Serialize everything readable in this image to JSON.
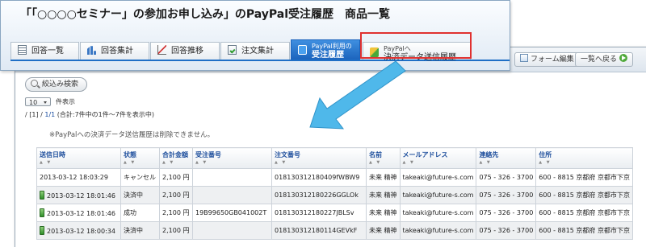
{
  "front": {
    "title": "「「○○○○セミナー」の参加お申し込み」のPayPal受注履歴　商品一覧",
    "tabs": [
      {
        "label": "回答一覧",
        "icon": "list-icon"
      },
      {
        "label": "回答集計",
        "icon": "bar-chart-icon"
      },
      {
        "label": "回答推移",
        "icon": "line-chart-icon"
      },
      {
        "label": "注文集計",
        "icon": "order-check-icon"
      },
      {
        "small": "PayPal利用の",
        "big": "受注履歴",
        "icon": "paypal-icon",
        "active": true
      },
      {
        "small": "PayPalへ",
        "big": "決済データ送信履歴",
        "icon": "send-icon"
      }
    ]
  },
  "back": {
    "toolbar": {
      "form_edit": "フォーム編集",
      "back_to_list": "一覧へ戻る"
    },
    "search_button": "絞込み検索",
    "per_page_value": "10",
    "per_page_label": "件表示",
    "pager_prefix": "/ [1] /",
    "pager_link": "1/1",
    "pager_info": "(合計:7件中の1件〜7件を表示中)",
    "notice": "※PayPalへの決済データ送信履歴は削除できません。",
    "table": {
      "sort_arrows": "▲ ▼",
      "headers": [
        "送信日時",
        "状態",
        "合計金額",
        "受注番号",
        "注文番号",
        "名前",
        "メールアドレス",
        "連絡先",
        "住所"
      ],
      "rows": [
        {
          "phone": false,
          "cells": [
            "2013-03-12 18:03:29",
            "キャンセル",
            "2,100 円",
            "",
            "018130312180409fWBW9",
            "未来 精神",
            "takeaki@future-s.com",
            "075 - 326 - 3700",
            "600 - 8815 京都府 京都市下京"
          ]
        },
        {
          "phone": true,
          "cells": [
            "2013-03-12 18:01:46",
            "決済中",
            "2,100 円",
            "",
            "018130312180226GGLOk",
            "未来 精神",
            "takeaki@future-s.com",
            "075 - 326 - 3700",
            "600 - 8815 京都府 京都市下京"
          ]
        },
        {
          "phone": true,
          "cells": [
            "2013-03-12 18:01:46",
            "成功",
            "2,100 円",
            "19B99650GB041002T",
            "018130312180227JBLSv",
            "未来 精神",
            "takeaki@future-s.com",
            "075 - 326 - 3700",
            "600 - 8815 京都府 京都市下京"
          ]
        },
        {
          "phone": true,
          "cells": [
            "2013-03-12 18:00:34",
            "決済中",
            "2,100 円",
            "",
            "018130312180114GEVkF",
            "未来 精神",
            "takeaki@future-s.com",
            "075 - 326 - 3700",
            "600 - 8815 京都府 京都市下京"
          ]
        }
      ]
    }
  },
  "colors": {
    "accent": "#1c64bd",
    "highlight": "#e0302f",
    "arrow": "#4fb8ea",
    "link": "#1d4e9c"
  }
}
